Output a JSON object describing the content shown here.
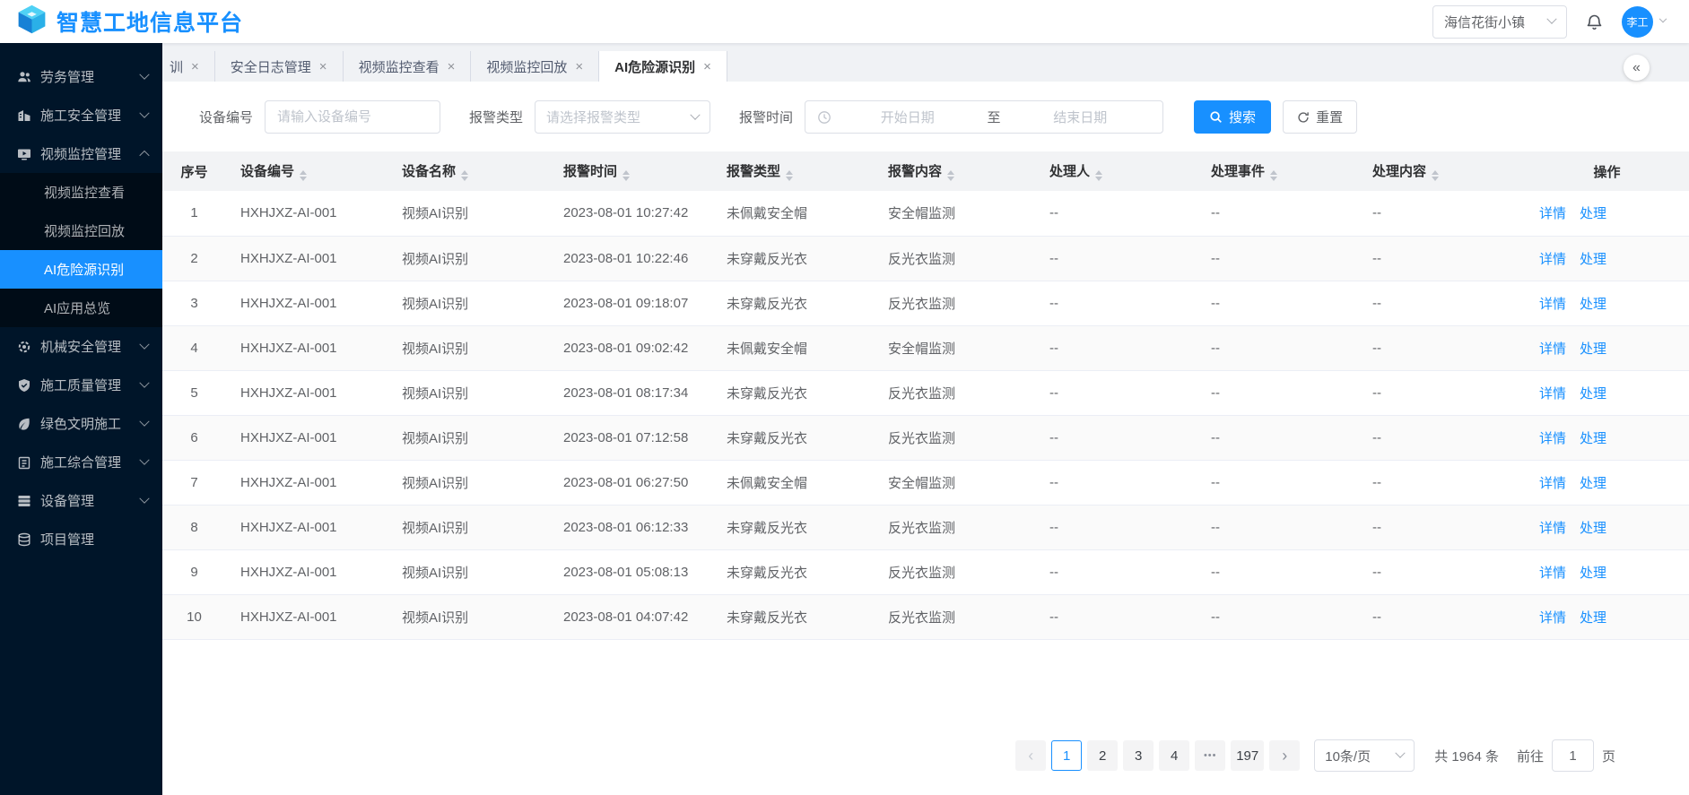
{
  "header": {
    "app_title": "智慧工地信息平台",
    "project_selector": {
      "value": "海信花街小镇"
    },
    "user": {
      "name": "李工"
    }
  },
  "sidebar": {
    "items": [
      {
        "label": "劳务管理",
        "icon": "team-icon"
      },
      {
        "label": "施工安全管理",
        "icon": "safety-icon"
      },
      {
        "label": "视频监控管理",
        "icon": "video-icon",
        "expanded": true,
        "children": [
          {
            "label": "视频监控查看"
          },
          {
            "label": "视频监控回放"
          },
          {
            "label": "AI危险源识别",
            "active": true
          },
          {
            "label": "AI应用总览"
          }
        ]
      },
      {
        "label": "机械安全管理",
        "icon": "machine-icon"
      },
      {
        "label": "施工质量管理",
        "icon": "quality-icon"
      },
      {
        "label": "绿色文明施工",
        "icon": "green-icon"
      },
      {
        "label": "施工综合管理",
        "icon": "composite-icon"
      },
      {
        "label": "设备管理",
        "icon": "device-icon"
      },
      {
        "label": "项目管理",
        "icon": "project-icon"
      }
    ]
  },
  "tabbar": {
    "tabs": [
      {
        "label": "训"
      },
      {
        "label": "安全日志管理"
      },
      {
        "label": "视频监控查看"
      },
      {
        "label": "视频监控回放"
      },
      {
        "label": "AI危险源识别",
        "active": true
      }
    ],
    "close_icon": "×",
    "collapse_icon": "«"
  },
  "filters": {
    "device_no_label": "设备编号",
    "device_no_placeholder": "请输入设备编号",
    "alarm_type_label": "报警类型",
    "alarm_type_placeholder": "请选择报警类型",
    "alarm_time_label": "报警时间",
    "start_placeholder": "开始日期",
    "range_separator": "至",
    "end_placeholder": "结束日期",
    "search_label": "搜索",
    "reset_label": "重置"
  },
  "table": {
    "columns": [
      "序号",
      "设备编号",
      "设备名称",
      "报警时间",
      "报警类型",
      "报警内容",
      "处理人",
      "处理事件",
      "处理内容",
      "操作"
    ],
    "actions": {
      "detail": "详情",
      "handle": "处理"
    },
    "rows": [
      {
        "index": "1",
        "device_no": "HXHJXZ-AI-001",
        "device_name": "视频AI识别",
        "time": "2023-08-01 10:27:42",
        "type": "未佩戴安全帽",
        "content": "安全帽监测",
        "handler": "--",
        "event": "--",
        "handle_content": "--"
      },
      {
        "index": "2",
        "device_no": "HXHJXZ-AI-001",
        "device_name": "视频AI识别",
        "time": "2023-08-01 10:22:46",
        "type": "未穿戴反光衣",
        "content": "反光衣监测",
        "handler": "--",
        "event": "--",
        "handle_content": "--"
      },
      {
        "index": "3",
        "device_no": "HXHJXZ-AI-001",
        "device_name": "视频AI识别",
        "time": "2023-08-01 09:18:07",
        "type": "未穿戴反光衣",
        "content": "反光衣监测",
        "handler": "--",
        "event": "--",
        "handle_content": "--"
      },
      {
        "index": "4",
        "device_no": "HXHJXZ-AI-001",
        "device_name": "视频AI识别",
        "time": "2023-08-01 09:02:42",
        "type": "未佩戴安全帽",
        "content": "安全帽监测",
        "handler": "--",
        "event": "--",
        "handle_content": "--"
      },
      {
        "index": "5",
        "device_no": "HXHJXZ-AI-001",
        "device_name": "视频AI识别",
        "time": "2023-08-01 08:17:34",
        "type": "未穿戴反光衣",
        "content": "反光衣监测",
        "handler": "--",
        "event": "--",
        "handle_content": "--"
      },
      {
        "index": "6",
        "device_no": "HXHJXZ-AI-001",
        "device_name": "视频AI识别",
        "time": "2023-08-01 07:12:58",
        "type": "未穿戴反光衣",
        "content": "反光衣监测",
        "handler": "--",
        "event": "--",
        "handle_content": "--"
      },
      {
        "index": "7",
        "device_no": "HXHJXZ-AI-001",
        "device_name": "视频AI识别",
        "time": "2023-08-01 06:27:50",
        "type": "未佩戴安全帽",
        "content": "安全帽监测",
        "handler": "--",
        "event": "--",
        "handle_content": "--"
      },
      {
        "index": "8",
        "device_no": "HXHJXZ-AI-001",
        "device_name": "视频AI识别",
        "time": "2023-08-01 06:12:33",
        "type": "未穿戴反光衣",
        "content": "反光衣监测",
        "handler": "--",
        "event": "--",
        "handle_content": "--"
      },
      {
        "index": "9",
        "device_no": "HXHJXZ-AI-001",
        "device_name": "视频AI识别",
        "time": "2023-08-01 05:08:13",
        "type": "未穿戴反光衣",
        "content": "反光衣监测",
        "handler": "--",
        "event": "--",
        "handle_content": "--"
      },
      {
        "index": "10",
        "device_no": "HXHJXZ-AI-001",
        "device_name": "视频AI识别",
        "time": "2023-08-01 04:07:42",
        "type": "未穿戴反光衣",
        "content": "反光衣监测",
        "handler": "--",
        "event": "--",
        "handle_content": "--"
      }
    ]
  },
  "pagination": {
    "prev_icon": "‹",
    "next_icon": "›",
    "pages": [
      "1",
      "2",
      "3",
      "4",
      "•••",
      "197"
    ],
    "active_page": "1",
    "page_size": "10条/页",
    "total": "共 1964 条",
    "goto_label": "前往",
    "goto_value": "1",
    "goto_unit": "页"
  },
  "colors": {
    "accent": "#1890ff",
    "sidebar_bg": "#001529",
    "submenu_bg": "#000c17",
    "content_bg": "#f0f2f5"
  }
}
